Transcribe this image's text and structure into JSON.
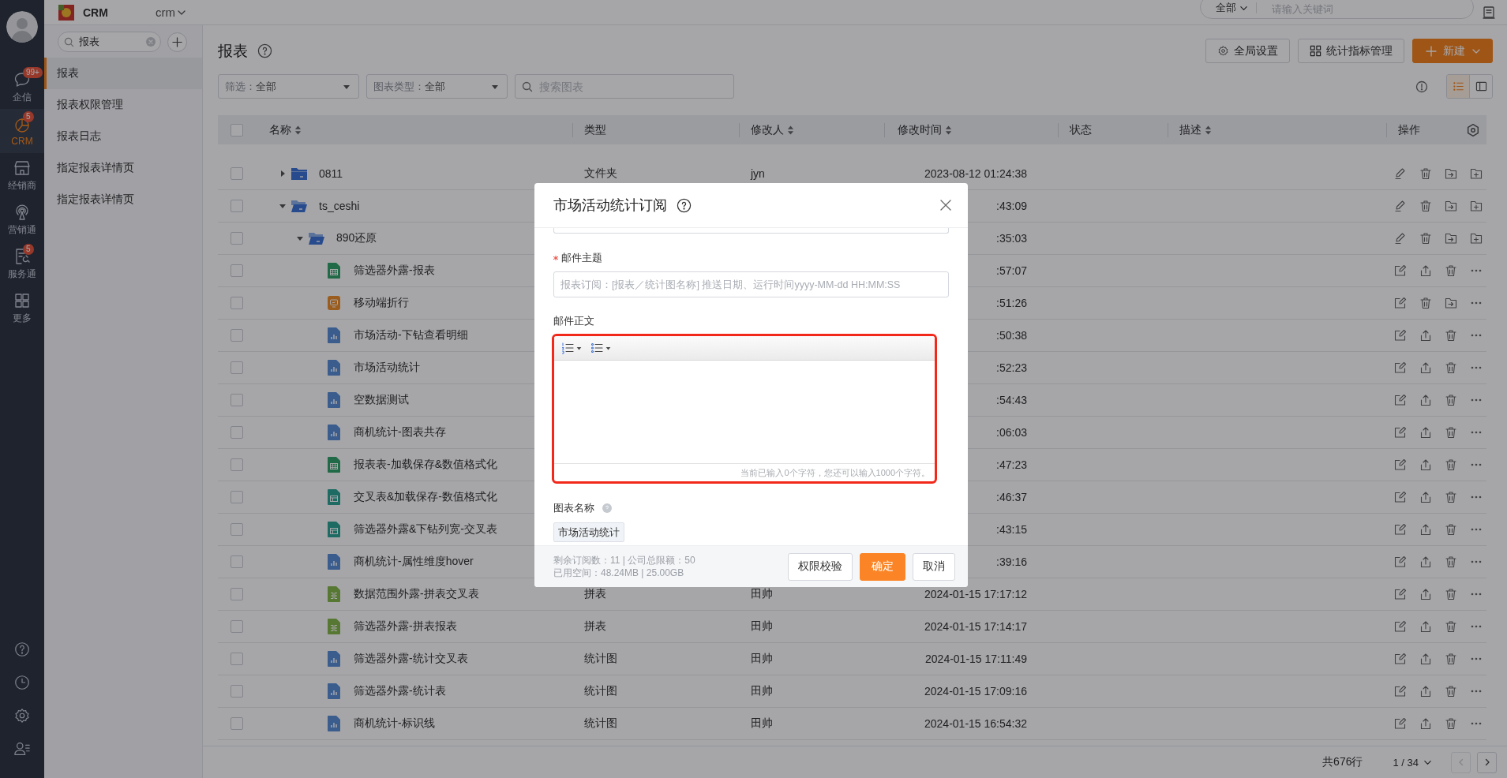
{
  "nav": {
    "items": [
      {
        "label": "企信",
        "badge": "99+",
        "selected": false
      },
      {
        "label": "CRM",
        "badge": "5",
        "selected": true
      },
      {
        "label": "经销商",
        "selected": false
      },
      {
        "label": "营销通",
        "selected": false
      },
      {
        "label": "服务通",
        "badge": "5",
        "selected": false
      },
      {
        "label": "更多",
        "selected": false
      }
    ]
  },
  "topbar": {
    "app_name": "CRM",
    "app_switch": "crm",
    "search": {
      "scope": "全部",
      "placeholder": "请输入关键词"
    }
  },
  "subnav": {
    "search": {
      "value": "报表"
    },
    "items": [
      {
        "label": "报表",
        "selected": true
      },
      {
        "label": "报表权限管理",
        "selected": false
      },
      {
        "label": "报表日志",
        "selected": false
      },
      {
        "label": "指定报表详情页",
        "selected": false
      },
      {
        "label": "指定报表详情页",
        "selected": false
      }
    ]
  },
  "page": {
    "title": "报表",
    "buttons": [
      {
        "label": "全局设置",
        "kind": "settings"
      },
      {
        "label": "统计指标管理",
        "kind": "grid"
      },
      {
        "label": "新建",
        "kind": "create"
      }
    ],
    "filters": [
      {
        "label": "筛选：",
        "value": "全部"
      },
      {
        "label": "图表类型：",
        "value": "全部"
      }
    ],
    "search": {
      "placeholder": "搜索图表"
    },
    "view_modes": [
      {
        "kind": "list",
        "selected": true
      },
      {
        "kind": "panel",
        "selected": false
      }
    ]
  },
  "table": {
    "all_checked": false,
    "columns": [
      {
        "label": "名称",
        "sortable": true
      },
      {
        "label": "类型",
        "sortable": false
      },
      {
        "label": "修改人",
        "sortable": true
      },
      {
        "label": "修改时间",
        "sortable": true
      },
      {
        "label": "状态",
        "sortable": false
      },
      {
        "label": "描述",
        "sortable": true
      },
      {
        "label": "操作",
        "sortable": false
      }
    ],
    "rows": [
      {
        "name": "0811",
        "kind": "folder",
        "checked": false,
        "expanded": false,
        "type": "文件夹",
        "modifier": "jyn",
        "time": "2023-08-12 01:24:38"
      },
      {
        "name": "ts_ceshi",
        "kind": "folder",
        "checked": false,
        "expanded": true,
        "time": ":43:09",
        "children": [
          {
            "name": "890还原",
            "kind": "folder",
            "checked": false,
            "expanded": true,
            "time": ":35:03",
            "children": [
              {
                "name": "筛选器外露-报表",
                "kind": "table",
                "checked": false,
                "time": ":57:07"
              },
              {
                "name": "移动端折行",
                "kind": "mobile",
                "checked": false,
                "time": ":51:26"
              },
              {
                "name": "市场活动-下钻查看明细",
                "kind": "chart",
                "checked": false,
                "time": ":50:38"
              },
              {
                "name": "市场活动统计",
                "kind": "chart",
                "checked": false,
                "time": ":52:23"
              },
              {
                "name": "空数据测试",
                "kind": "chart",
                "checked": false,
                "time": ":54:43"
              },
              {
                "name": "商机统计-图表共存",
                "kind": "chart",
                "checked": false,
                "time": ":06:03"
              },
              {
                "name": "报表表-加载保存&数值格式化",
                "kind": "table",
                "checked": false,
                "time": ":47:23"
              },
              {
                "name": "交叉表&加载保存-数值格式化",
                "kind": "crosstab",
                "checked": false,
                "time": ":46:37"
              },
              {
                "name": "筛选器外露&下钻列宽-交叉表",
                "kind": "crosstab",
                "checked": false,
                "time": ":43:15"
              },
              {
                "name": "商机统计-属性维度hover",
                "kind": "chart",
                "checked": false,
                "time": ":39:16"
              },
              {
                "name": "数据范围外露-拼表交叉表",
                "kind": "join",
                "checked": false,
                "type": "拼表",
                "modifier": "田帅",
                "time": "2024-01-15 17:17:12"
              },
              {
                "name": "筛选器外露-拼表报表",
                "kind": "join",
                "checked": false,
                "type": "拼表",
                "modifier": "田帅",
                "time": "2024-01-15 17:14:17"
              },
              {
                "name": "筛选器外露-统计交叉表",
                "kind": "chart",
                "checked": false,
                "type": "统计图",
                "modifier": "田帅",
                "time": "2024-01-15 17:11:49"
              },
              {
                "name": "筛选器外露-统计表",
                "kind": "chart",
                "checked": false,
                "type": "统计图",
                "modifier": "田帅",
                "time": "2024-01-15 17:09:16"
              },
              {
                "name": "商机统计-标识线",
                "kind": "chart",
                "checked": false,
                "type": "统计图",
                "modifier": "田帅",
                "time": "2024-01-15 16:54:32"
              }
            ]
          }
        ]
      }
    ]
  },
  "pagination": {
    "total": "共676行",
    "page": "1 / 34",
    "prev_disabled": true,
    "next_disabled": false
  },
  "dialog": {
    "title": "市场活动统计订阅",
    "subject": {
      "label": "邮件主题",
      "required": true,
      "placeholder": "报表订阅：[报表／统计图名称] 推送日期、运行时间yyyy-MM-dd HH:MM:SS"
    },
    "body": {
      "label": "邮件正文",
      "counter": "当前已输入0个字符，您还可以输入1000个字符。",
      "highlighted": true
    },
    "chart_name": {
      "label": "图表名称",
      "tags": [
        "市场活动统计"
      ]
    },
    "quota": [
      "剩余订阅数：11 | 公司总限额：50",
      "已用空间：48.24MB | 25.00GB"
    ],
    "buttons": [
      {
        "label": "权限校验",
        "primary": false
      },
      {
        "label": "确定",
        "primary": true
      },
      {
        "label": "取消",
        "primary": false
      }
    ]
  }
}
